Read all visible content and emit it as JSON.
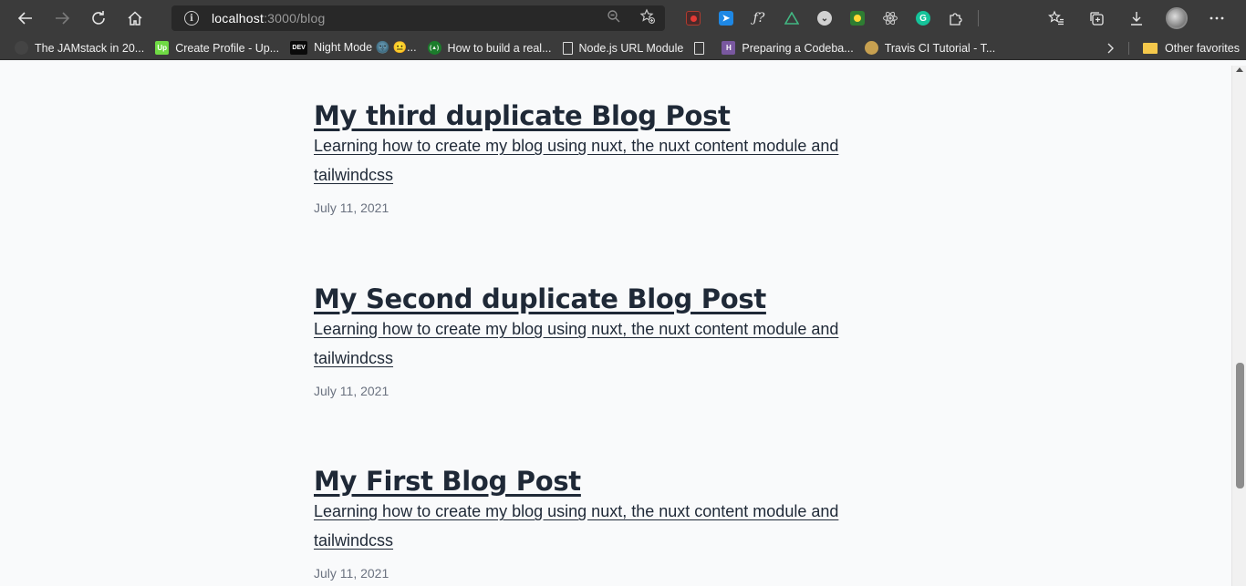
{
  "toolbar": {
    "back_icon": "back-arrow-icon",
    "forward_icon": "forward-arrow-icon",
    "refresh_icon": "refresh-icon",
    "home_icon": "home-icon",
    "url_host": "localhost",
    "url_rest": ":3000/blog",
    "zoom_icon": "zoom-out-icon",
    "favorite_icon": "add-favorite-icon",
    "extensions": [
      {
        "name": "screen-recorder-extension-icon",
        "color": "#b03a2e"
      },
      {
        "name": "translator-extension-icon",
        "color": "#1e88e5"
      },
      {
        "name": "formula-extension-icon",
        "color": "#3b3b3b"
      },
      {
        "name": "vue-devtools-extension-icon",
        "color": "#42b883"
      },
      {
        "name": "pocket-extension-icon",
        "color": "#d0d0d0"
      },
      {
        "name": "maps-extension-icon",
        "color": "#2e7d32"
      },
      {
        "name": "react-devtools-extension-icon",
        "color": "#61dafb"
      },
      {
        "name": "grammarly-extension-icon",
        "color": "#15c39a"
      },
      {
        "name": "puzzle-extensions-icon",
        "color": "#e6e6e6"
      }
    ],
    "right_icons": [
      "favorites-icon",
      "collections-icon",
      "downloads-icon",
      "profile-avatar",
      "more-menu-icon"
    ]
  },
  "bookmarks": [
    {
      "label": "The JAMstack in 20...",
      "icon": "jamstack-icon",
      "color": "#444444",
      "text": ""
    },
    {
      "label": "Create Profile - Up...",
      "icon": "upwork-icon",
      "color": "#6fda44",
      "text": "Up"
    },
    {
      "label": "Night Mode 🌚 😐...",
      "icon": "dev-icon",
      "color": "#0a0a0a",
      "text": "DEV"
    },
    {
      "label": "How to build a real...",
      "icon": "site-icon",
      "color": "#1c7c2c",
      "text": "(▲)"
    },
    {
      "label": "Node.js URL Module",
      "icon": "document-icon",
      "color": "",
      "text": ""
    },
    {
      "label": "",
      "icon": "document-icon",
      "color": "",
      "text": ""
    },
    {
      "label": "Preparing a Codeba...",
      "icon": "heroku-icon",
      "color": "#79589f",
      "text": "H"
    },
    {
      "label": "Travis CI Tutorial - T...",
      "icon": "travis-icon",
      "color": "#c7a050",
      "text": ""
    }
  ],
  "bookmarks_other": "Other favorites",
  "posts": [
    {
      "title": "My third duplicate Blog Post",
      "description": "Learning how to create my blog using nuxt, the nuxt content module and tailwindcss",
      "date": "July 11, 2021"
    },
    {
      "title": "My Second duplicate Blog Post",
      "description": "Learning how to create my blog using nuxt, the nuxt content module and tailwindcss",
      "date": "July 11, 2021"
    },
    {
      "title": "My First Blog Post",
      "description": "Learning how to create my blog using nuxt, the nuxt content module and tailwindcss",
      "date": "July 11, 2021"
    }
  ]
}
